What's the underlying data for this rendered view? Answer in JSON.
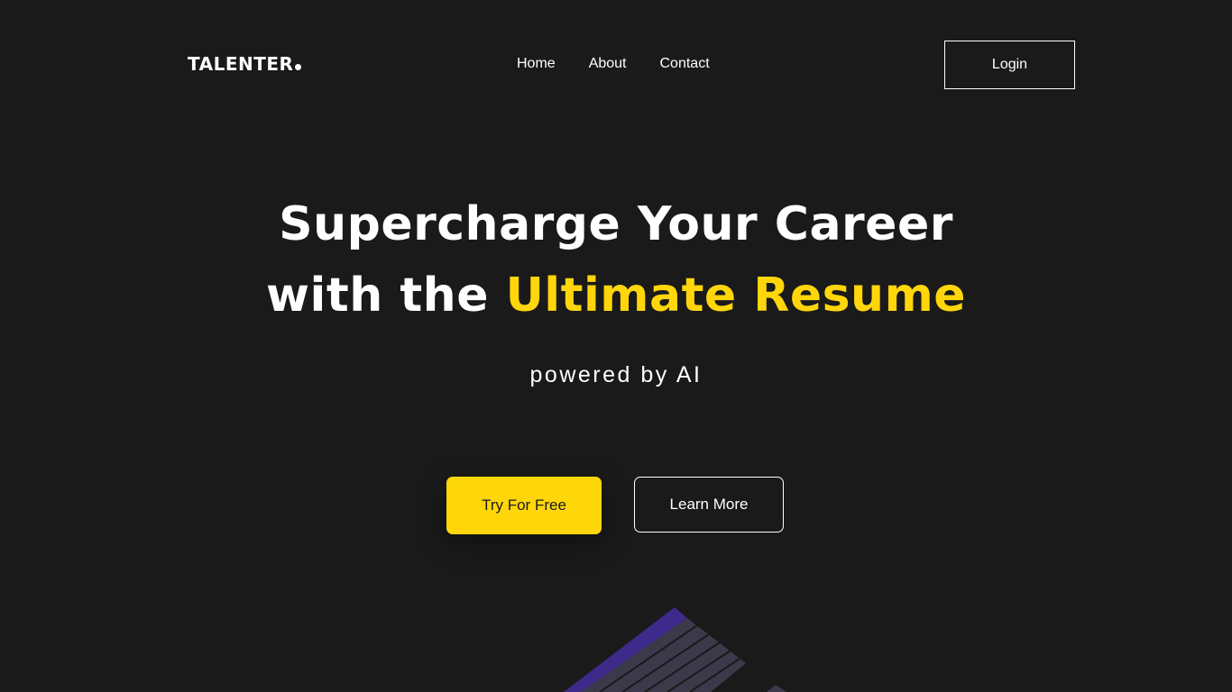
{
  "header": {
    "logo_text": "TALENTER",
    "nav": [
      {
        "label": "Home"
      },
      {
        "label": "About"
      },
      {
        "label": "Contact"
      }
    ],
    "login_label": "Login"
  },
  "hero": {
    "title_line1": "Supercharge Your Career",
    "title_line2_prefix": "with the ",
    "title_line2_accent": "Ultimate Resume",
    "subtitle": "powered by AI",
    "primary_cta": "Try For Free",
    "secondary_cta": "Learn More"
  },
  "colors": {
    "background": "#1a1a1b",
    "accent": "#ffd60a",
    "text": "#ffffff",
    "illustration_purple": "#3d2a8a",
    "illustration_slate": "#3a3a4a"
  },
  "icons": {
    "logo_dot": "dot-icon",
    "illustration": "resume-illustration"
  }
}
